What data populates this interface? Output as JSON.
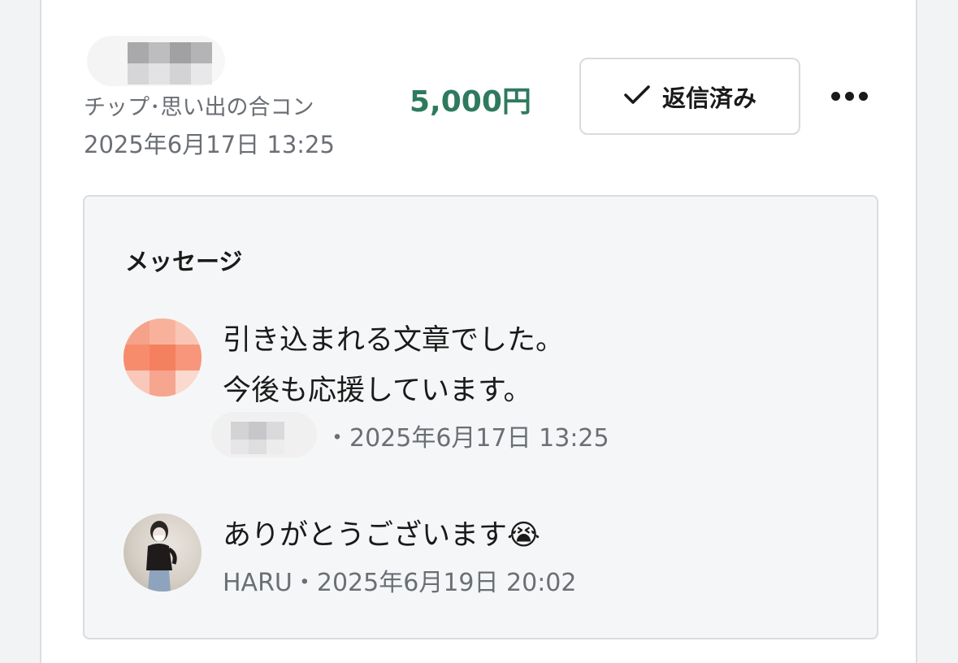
{
  "tip": {
    "category": "チップ･思い出の合コン",
    "datetime": "2025年6月17日 13:25",
    "amount": "5,000円",
    "status_button_label": "返信済み",
    "more_icon": "ellipsis-icon"
  },
  "colors": {
    "amount": "#2f7a5e",
    "panel_bg": "#f5f6f7",
    "muted_text": "#6b6f75"
  },
  "messages_panel": {
    "title": "メッセージ",
    "messages": [
      {
        "lines": [
          "引き込まれる文章でした。",
          "今後も応援しています。"
        ],
        "meta": "・2025年6月17日 13:25"
      },
      {
        "lines": [
          "ありがとうございます😭"
        ],
        "meta": "HARU・2025年6月19日 20:02"
      }
    ]
  }
}
